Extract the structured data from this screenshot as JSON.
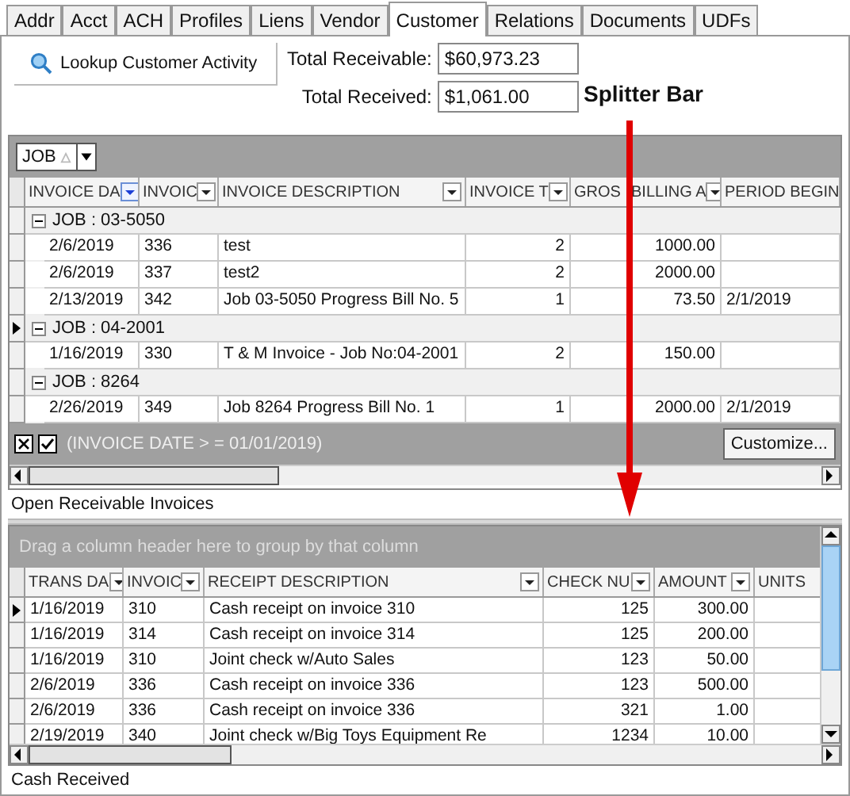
{
  "tabs": [
    {
      "label": "Addr",
      "selected": false
    },
    {
      "label": "Acct",
      "selected": false
    },
    {
      "label": "ACH",
      "selected": false
    },
    {
      "label": "Profiles",
      "selected": false
    },
    {
      "label": "Liens",
      "selected": false
    },
    {
      "label": "Vendor",
      "selected": false
    },
    {
      "label": "Customer",
      "selected": true
    },
    {
      "label": "Relations",
      "selected": false
    },
    {
      "label": "Documents",
      "selected": false
    },
    {
      "label": "UDFs",
      "selected": false
    }
  ],
  "lookup_button": "Lookup Customer Activity",
  "totals": [
    {
      "label": "Total Receivable:",
      "value": "$60,973.23"
    },
    {
      "label": "Total Received:",
      "value": "$1,061.00"
    }
  ],
  "annotation": "Splitter Bar",
  "invoices": {
    "group_chip": "JOB",
    "columns": [
      {
        "label": "INVOICE DA",
        "filter_button": true,
        "filter_active": true
      },
      {
        "label": "INVOIC",
        "filter_button": true,
        "filter_active": false
      },
      {
        "label": "INVOICE DESCRIPTION",
        "filter_button": true,
        "filter_active": false
      },
      {
        "label": "INVOICE T",
        "filter_button": true,
        "filter_active": false
      },
      {
        "label": "GROS"
      },
      {
        "label": "BILLING A",
        "filter_button": true,
        "filter_active": false
      },
      {
        "label": "PERIOD BEGIN"
      }
    ],
    "groups": [
      {
        "label": "JOB : 03-5050",
        "expanded": true,
        "current": false,
        "rows": [
          {
            "cells": [
              "2/6/2019",
              "336",
              "test",
              "2",
              "",
              "1000.00",
              ""
            ]
          },
          {
            "cells": [
              "2/6/2019",
              "337",
              "test2",
              "2",
              "",
              "2000.00",
              ""
            ]
          },
          {
            "cells": [
              "2/13/2019",
              "342",
              "Job 03-5050 Progress Bill No. 5",
              "1",
              "",
              "73.50",
              "2/1/2019"
            ]
          }
        ]
      },
      {
        "label": "JOB : 04-2001",
        "expanded": true,
        "current": true,
        "rows": [
          {
            "cells": [
              "1/16/2019",
              "330",
              "T & M Invoice - Job No:04-2001",
              "2",
              "",
              "150.00",
              ""
            ]
          }
        ]
      },
      {
        "label": "JOB : 8264",
        "expanded": true,
        "current": false,
        "rows": [
          {
            "cells": [
              "2/26/2019",
              "349",
              "Job 8264 Progress Bill No. 1",
              "1",
              "",
              "2000.00",
              "2/1/2019"
            ]
          }
        ]
      }
    ],
    "filter": {
      "enabled": true,
      "text": "(INVOICE DATE > = 01/01/2019)"
    },
    "customize_button": "Customize...",
    "caption": "Open Receivable Invoices"
  },
  "receipts": {
    "group_hint": "Drag a column header here to group by that column",
    "columns": [
      {
        "label": "TRANS DA",
        "filter_button": true,
        "filter_active": false
      },
      {
        "label": "INVOIC",
        "filter_button": true,
        "filter_active": false
      },
      {
        "label": "RECEIPT DESCRIPTION",
        "filter_button": true,
        "filter_active": false
      },
      {
        "label": "CHECK NU",
        "filter_button": true,
        "filter_active": false
      },
      {
        "label": "AMOUNT",
        "filter_button": true,
        "filter_active": false
      },
      {
        "label": "UNITS"
      }
    ],
    "rows": [
      {
        "current": true,
        "cells": [
          "1/16/2019",
          "310",
          "Cash receipt on invoice 310",
          "125",
          "300.00",
          ""
        ]
      },
      {
        "current": false,
        "cells": [
          "1/16/2019",
          "314",
          "Cash receipt on invoice 314",
          "125",
          "200.00",
          ""
        ]
      },
      {
        "current": false,
        "cells": [
          "1/16/2019",
          "310",
          "Joint check w/Auto Sales",
          "123",
          "50.00",
          ""
        ]
      },
      {
        "current": false,
        "cells": [
          "2/6/2019",
          "336",
          "Cash receipt on invoice 336",
          "123",
          "500.00",
          ""
        ]
      },
      {
        "current": false,
        "cells": [
          "2/6/2019",
          "336",
          "Cash receipt on invoice 336",
          "321",
          "1.00",
          ""
        ]
      },
      {
        "current": false,
        "cells": [
          "2/19/2019",
          "340",
          "Joint check w/Big Toys Equipment Re",
          "1234",
          "10.00",
          ""
        ]
      }
    ],
    "caption": "Cash Received"
  }
}
